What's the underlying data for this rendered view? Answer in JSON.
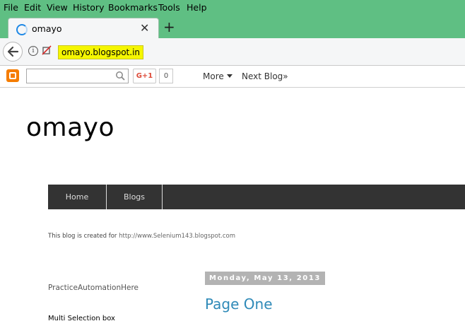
{
  "menubar": {
    "items": [
      {
        "label": "File"
      },
      {
        "label": "Edit"
      },
      {
        "label": "View"
      },
      {
        "label": "History"
      },
      {
        "label": "Bookmarks"
      },
      {
        "label": "Tools"
      },
      {
        "label": "Help"
      }
    ]
  },
  "tab": {
    "title": "omayo",
    "close_icon": "close-icon",
    "new_tab_label": "+"
  },
  "address": {
    "url": "omayo.blogspot.in"
  },
  "blogger_bar": {
    "search_placeholder": "",
    "gplus_label": "G+1",
    "gplus_count": "0",
    "more_label": "More",
    "next_blog_label": "Next Blog»"
  },
  "blog": {
    "title": "omayo",
    "nav_tabs": [
      {
        "label": "Home"
      },
      {
        "label": "Blogs"
      }
    ],
    "description_prefix": "This blog is created for ",
    "description_link": "http://www.Selenium143.blogspot.com",
    "sidebar_title": "PracticeAutomationHere",
    "multi_select_label": "Multi Selection box",
    "post_date": "Monday, May 13, 2013",
    "post_title": "Page One"
  },
  "colors": {
    "chrome_green": "#5fbf83",
    "url_highlight": "#f5f600",
    "nav_tabs_bg": "#333333",
    "post_title": "#2f8ab8"
  }
}
